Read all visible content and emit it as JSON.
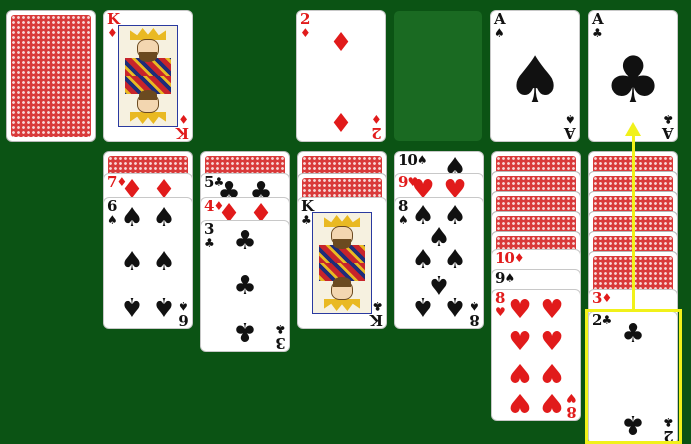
{
  "stock": {
    "kind": "back"
  },
  "waste": {
    "rank": "K",
    "suit": "♦",
    "color": "red"
  },
  "foundations": [
    {
      "rank": "2",
      "suit": "♦",
      "color": "red"
    },
    {
      "rank": "",
      "suit": "",
      "color": "empty"
    },
    {
      "rank": "A",
      "suit": "♠",
      "color": "black"
    },
    {
      "rank": "A",
      "suit": "♣",
      "color": "black"
    }
  ],
  "tableau": [
    {
      "id": "col1",
      "hidden": 1,
      "faceup": [
        {
          "rank": "7",
          "suit": "♦",
          "color": "red"
        },
        {
          "rank": "6",
          "suit": "♠",
          "color": "black"
        }
      ]
    },
    {
      "id": "col2",
      "hidden": 1,
      "faceup": [
        {
          "rank": "5",
          "suit": "♣",
          "color": "black"
        },
        {
          "rank": "4",
          "suit": "♦",
          "color": "red"
        },
        {
          "rank": "3",
          "suit": "♣",
          "color": "black"
        }
      ]
    },
    {
      "id": "col3",
      "hidden": 2,
      "faceup": [
        {
          "rank": "K",
          "suit": "♣",
          "color": "black"
        }
      ]
    },
    {
      "id": "col4",
      "hidden": 0,
      "faceup": [
        {
          "rank": "10",
          "suit": "♠",
          "color": "black"
        },
        {
          "rank": "9",
          "suit": "♥",
          "color": "red"
        },
        {
          "rank": "8",
          "suit": "♠",
          "color": "black"
        }
      ]
    },
    {
      "id": "col5",
      "hidden": 5,
      "faceup": [
        {
          "rank": "10",
          "suit": "♦",
          "color": "red"
        },
        {
          "rank": "9",
          "suit": "♠",
          "color": "black"
        },
        {
          "rank": "8",
          "suit": "♥",
          "color": "red"
        }
      ]
    },
    {
      "id": "col6",
      "hidden": 6,
      "faceup": [
        {
          "rank": "3",
          "suit": "♦",
          "color": "red"
        },
        {
          "rank": "2",
          "suit": "♣",
          "color": "black"
        }
      ]
    }
  ],
  "hint": {
    "from": "col6 2♣",
    "to": "foundation A♣",
    "color": "#f1f11a"
  },
  "colors": {
    "felt": "#0b5314",
    "red": "#e11b1b",
    "black": "#111111",
    "card_back": "#d93a3a"
  }
}
